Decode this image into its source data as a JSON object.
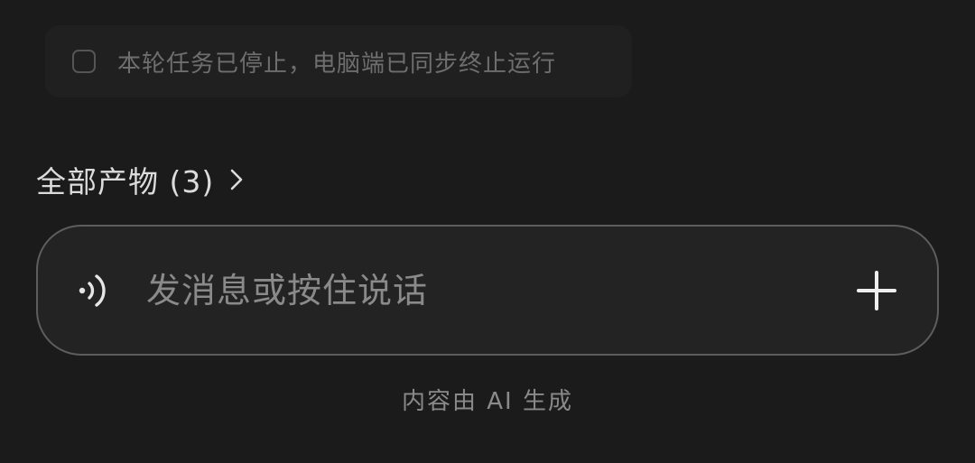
{
  "status_card": {
    "text": "本轮任务已停止，电脑端已同步终止运行",
    "checked": false
  },
  "artifacts": {
    "label": "全部产物 (3)"
  },
  "composer": {
    "placeholder": "发消息或按住说话",
    "value": ""
  },
  "footer": {
    "disclaimer": "内容由 AI 生成"
  },
  "icons": {
    "voice": "voice-wave-icon",
    "add": "plus-icon",
    "chevron": "chevron-right-icon"
  }
}
